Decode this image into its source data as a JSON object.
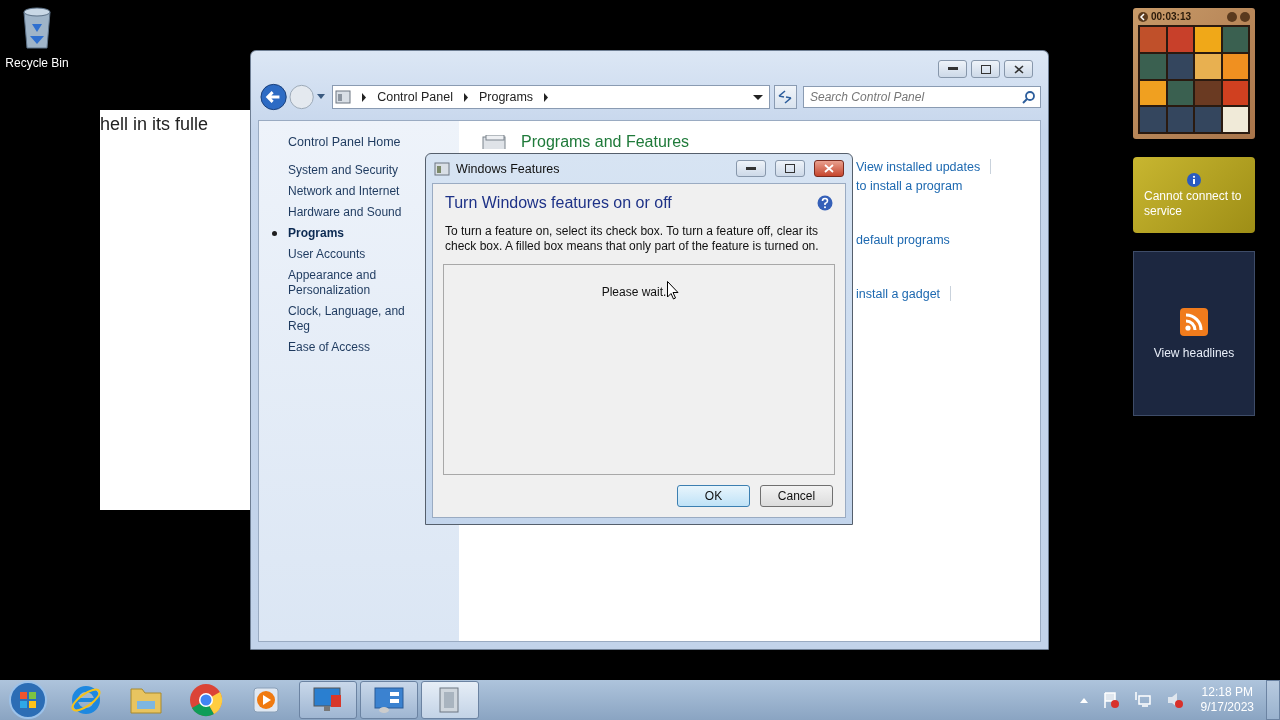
{
  "desktop_icons": [
    {
      "label": "Recycle Bin"
    }
  ],
  "background_window": {
    "text": "hell in its fulle"
  },
  "control_panel": {
    "breadcrumbs": [
      "Control Panel",
      "Programs"
    ],
    "search": {
      "placeholder": "Search Control Panel"
    },
    "sidebar": {
      "home": "Control Panel Home",
      "items": [
        {
          "label": "System and Security",
          "selected": false
        },
        {
          "label": "Network and Internet",
          "selected": false
        },
        {
          "label": "Hardware and Sound",
          "selected": false
        },
        {
          "label": "Programs",
          "selected": true
        },
        {
          "label": "User Accounts",
          "selected": false
        },
        {
          "label": "Appearance and Personalization",
          "selected": false
        },
        {
          "label": "Clock, Language, and Reg",
          "selected": false
        },
        {
          "label": "Ease of Access",
          "selected": false
        }
      ]
    },
    "content": {
      "title": "Programs and Features",
      "sections": [
        {
          "links": [
            {
              "text": "View installed updates",
              "separator": true
            },
            {
              "text": "to install a program",
              "separator": false
            }
          ]
        },
        {
          "links": [
            {
              "text": "default programs",
              "separator": false
            }
          ]
        },
        {
          "links": [
            {
              "text": "install a gadget",
              "separator": true
            }
          ]
        }
      ]
    }
  },
  "dialog": {
    "title": "Windows Features",
    "heading": "Turn Windows features on or off",
    "description": "To turn a feature on, select its check box. To turn a feature off, clear its check box. A filled box means that only part of the feature is turned on.",
    "status": "Please wait.",
    "buttons": [
      {
        "label": "OK",
        "default": true
      },
      {
        "label": "Cancel",
        "default": false
      }
    ]
  },
  "gadgets": [
    {
      "kind": "puzzle",
      "timer": "00:03:13"
    },
    {
      "kind": "currency",
      "message": "Cannot connect to service"
    },
    {
      "kind": "feed",
      "message": "View headlines"
    }
  ],
  "taskbar": {
    "items": [
      {
        "kind": "start",
        "open": false,
        "active": false
      },
      {
        "kind": "ie",
        "open": false,
        "active": false
      },
      {
        "kind": "explorer",
        "open": false,
        "active": false
      },
      {
        "kind": "chrome",
        "open": false,
        "active": false
      },
      {
        "kind": "media",
        "open": false,
        "active": false
      },
      {
        "kind": "display",
        "open": true,
        "active": false
      },
      {
        "kind": "control",
        "open": true,
        "active": false
      },
      {
        "kind": "features",
        "open": true,
        "active": true
      }
    ],
    "time": "12:18 PM",
    "date": "9/17/2023"
  }
}
